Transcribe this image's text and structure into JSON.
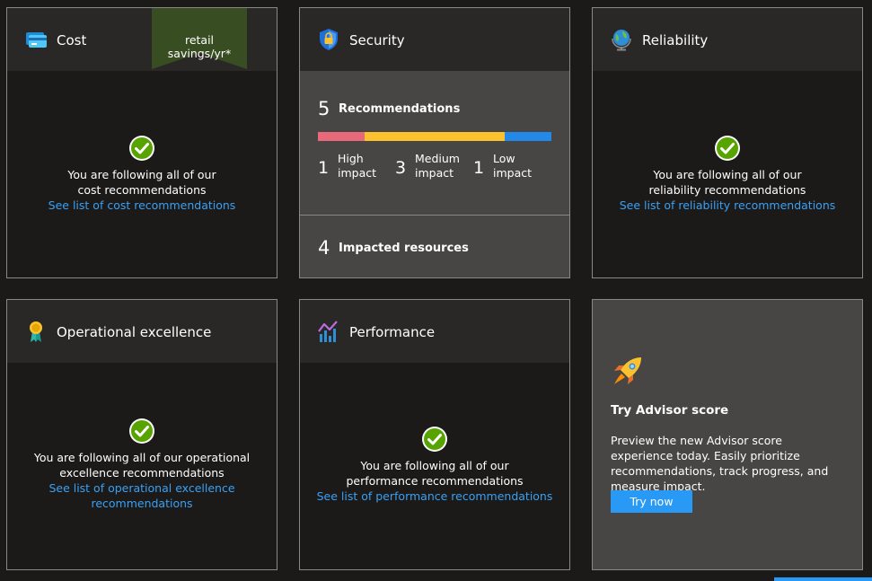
{
  "cost": {
    "title": "Cost",
    "ribbon": "retail savings/yr*",
    "message": "You are following all of our cost recommendations",
    "link": "See list of cost recommendations"
  },
  "security": {
    "title": "Security",
    "recommendations_count": "5",
    "recommendations_label": "Recommendations",
    "high_count": "1",
    "high_label_1": "High",
    "high_label_2": "impact",
    "medium_count": "3",
    "medium_label_1": "Medium",
    "medium_label_2": "impact",
    "low_count": "1",
    "low_label_1": "Low",
    "low_label_2": "impact",
    "impacted_count": "4",
    "impacted_label": "Impacted resources",
    "colors": {
      "high": "#e8697a",
      "medium": "#fcc12f",
      "low": "#2488e8"
    }
  },
  "reliability": {
    "title": "Reliability",
    "message": "You are following all of our reliability recommendations",
    "link": "See list of reliability recommendations"
  },
  "operational": {
    "title": "Operational excellence",
    "message": "You are following all of our operational excellence recommendations",
    "link": "See list of operational excellence recommendations"
  },
  "performance": {
    "title": "Performance",
    "message": "You are following all of our performance recommendations",
    "link": "See list of performance recommendations"
  },
  "advisor": {
    "title": "Try Advisor score",
    "description": "Preview the new Advisor score experience today. Easily prioritize recommendations, track progress, and measure impact.",
    "button": "Try now"
  }
}
